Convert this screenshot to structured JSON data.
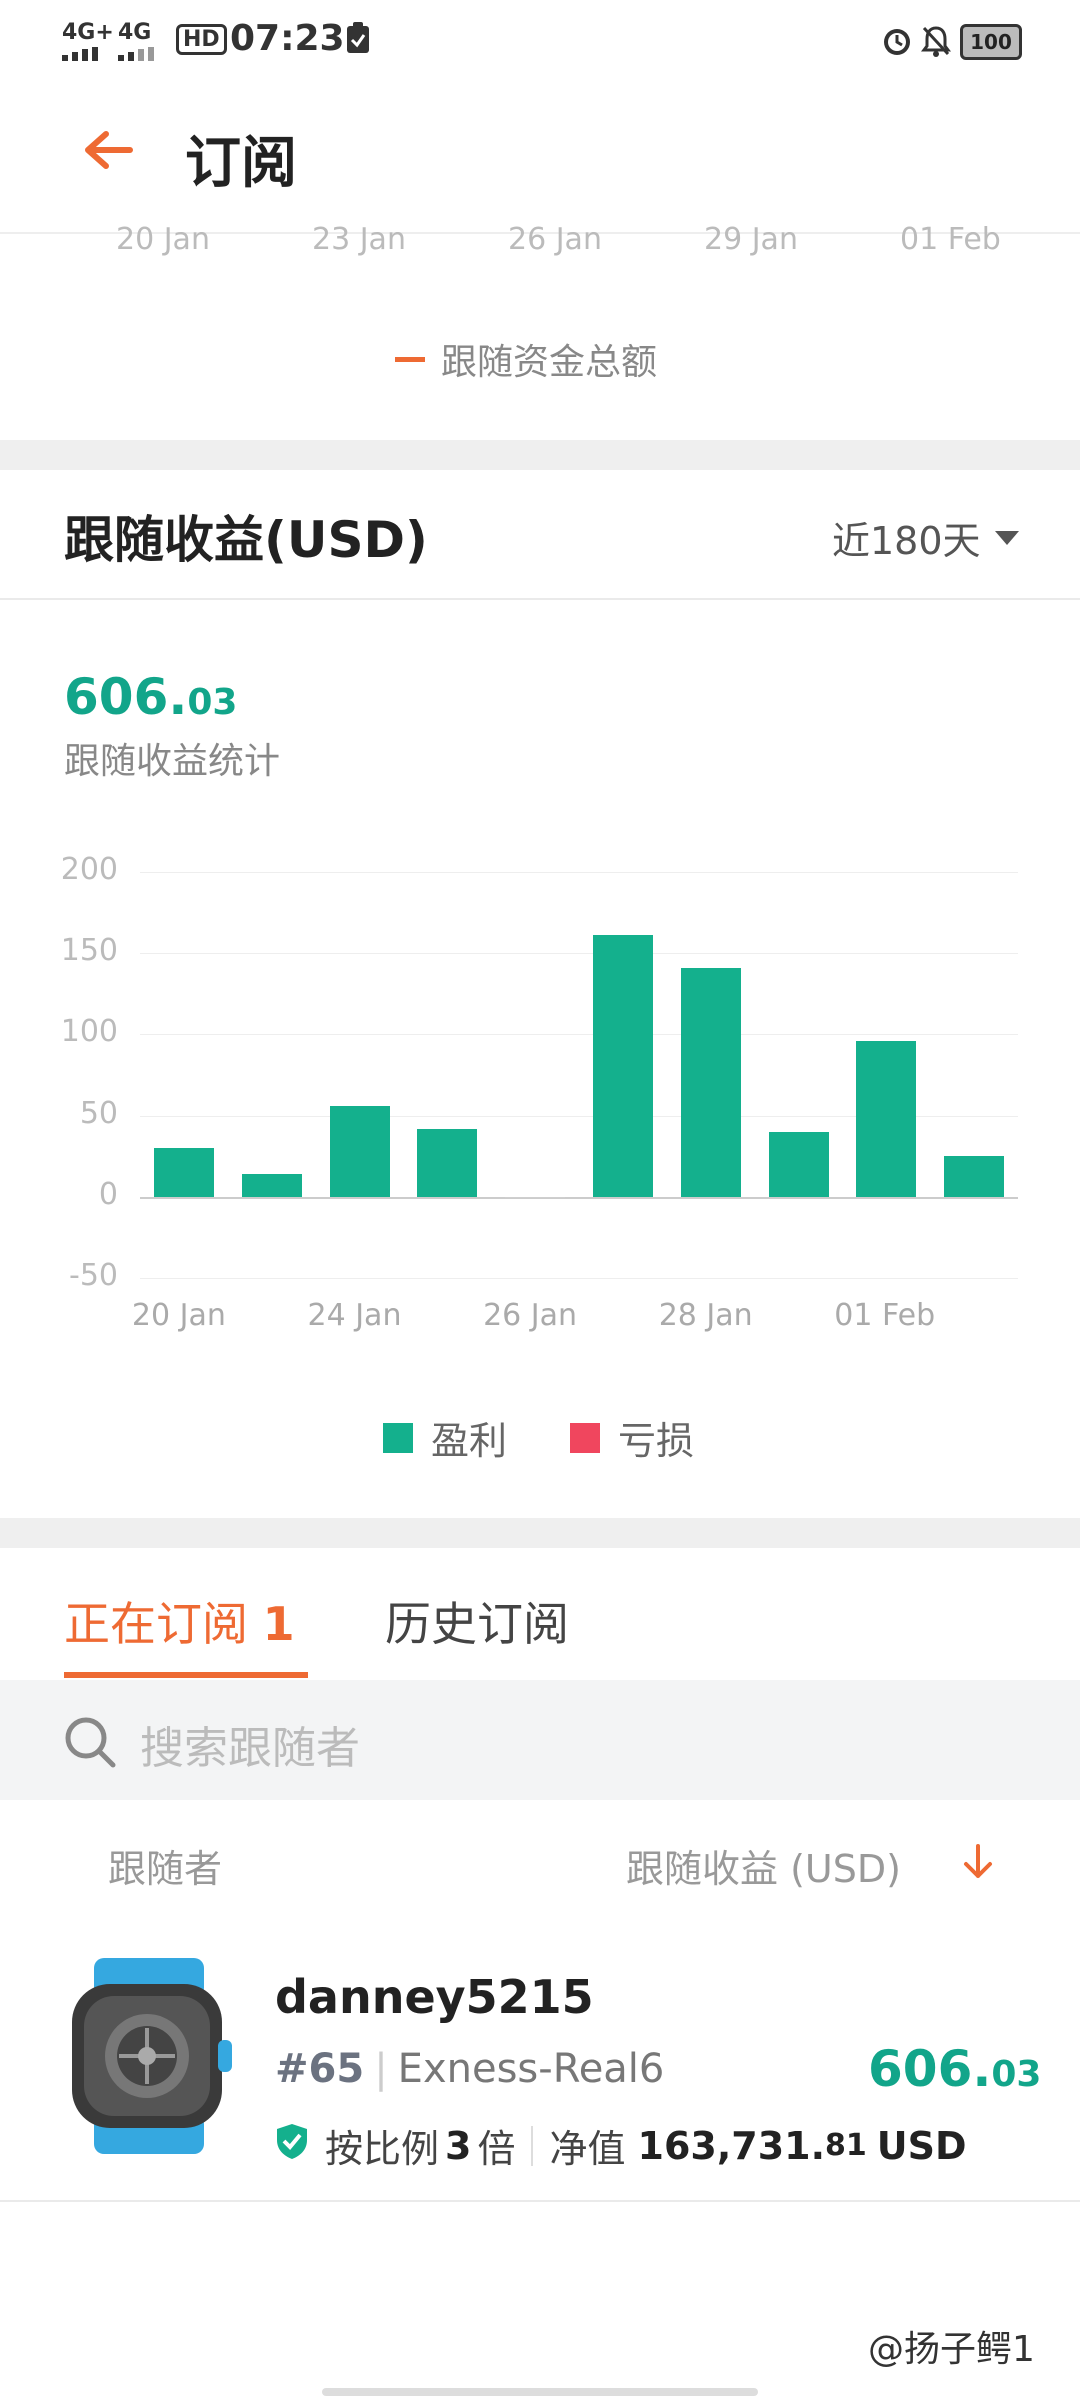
{
  "status_bar": {
    "signal1": "4G+",
    "signal2": "4G",
    "hd": "HD",
    "time": "07:23",
    "battery": "100"
  },
  "header": {
    "title": "订阅"
  },
  "top_chart": {
    "x_ticks": [
      "20 Jan",
      "23 Jan",
      "26 Jan",
      "29 Jan",
      "01 Feb"
    ],
    "legend": "跟随资金总额",
    "legend_color": "#ee6a33"
  },
  "profit_section": {
    "title": "跟随收益(USD)",
    "range": "近180天",
    "total_int": "606.",
    "total_dec": "03",
    "total_label": "跟随收益统计"
  },
  "chart_data": {
    "type": "bar",
    "categories": [
      "20 Jan",
      "",
      "24 Jan",
      "",
      "26 Jan",
      "",
      "28 Jan",
      "",
      "01 Feb",
      ""
    ],
    "x_tick_labels": [
      "20 Jan",
      "24 Jan",
      "26 Jan",
      "28 Jan",
      "01 Feb"
    ],
    "series": [
      {
        "name": "盈利",
        "color": "#14b08d",
        "values": [
          30,
          14,
          56,
          42,
          0,
          161,
          141,
          40,
          96,
          25
        ]
      }
    ],
    "y_ticks": [
      "200",
      "150",
      "100",
      "50",
      "0",
      "-50"
    ],
    "ylim": [
      -50,
      200
    ],
    "legend": [
      {
        "label": "盈利",
        "color": "#14b08d"
      },
      {
        "label": "亏损",
        "color": "#f0465e"
      }
    ],
    "grid": true,
    "legend_position": "bottom"
  },
  "tabs": {
    "active_label": "正在订阅",
    "active_count": "1",
    "other_label": "历史订阅"
  },
  "search": {
    "placeholder": "搜索跟随者"
  },
  "columns": {
    "follower": "跟随者",
    "profit": "跟随收益 (USD)"
  },
  "follower": {
    "name": "danney5215",
    "rank": "#65",
    "account": "Exness-Real6",
    "profit_int": "606.",
    "profit_dec": "03",
    "ratio_label": "按比例",
    "ratio_value": "3",
    "ratio_unit": "倍",
    "equity_label": "净值",
    "equity_int": "163,731.",
    "equity_dec": "81",
    "equity_currency": "USD"
  },
  "watermark": "@扬子鳄1"
}
